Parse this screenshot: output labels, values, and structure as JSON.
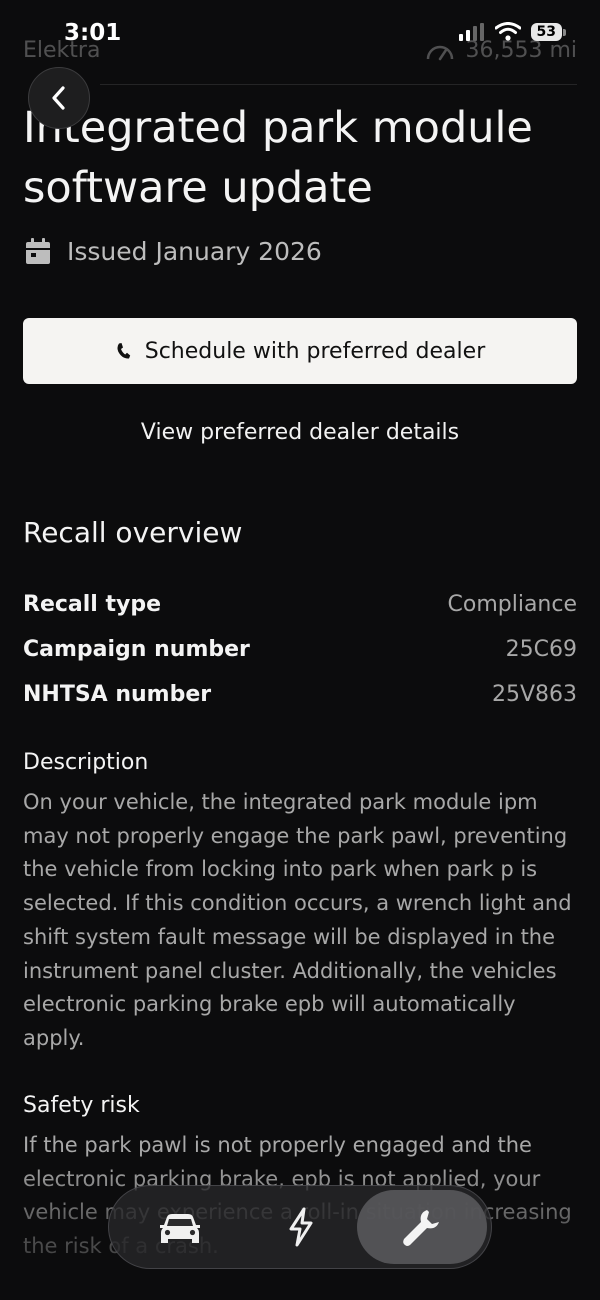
{
  "status_bar": {
    "time": "3:01",
    "battery": "53"
  },
  "header": {
    "vehicle_name": "Elektra",
    "mileage": "36,553 mi"
  },
  "title": "Integrated park module software update",
  "issued": "Issued January 2026",
  "schedule_button": "Schedule with preferred dealer",
  "dealer_link": "View preferred dealer details",
  "overview": {
    "title": "Recall overview",
    "rows": [
      {
        "label": "Recall type",
        "value": "Compliance"
      },
      {
        "label": "Campaign number",
        "value": "25C69"
      },
      {
        "label": "NHTSA number",
        "value": "25V863"
      }
    ]
  },
  "description": {
    "heading": "Description",
    "text": "On your vehicle, the integrated park module ipm may not properly engage the park pawl, preventing the vehicle from locking into park when park p is selected. If this condition occurs, a wrench light and shift system fault message will be displayed in the instrument panel cluster. Additionally, the vehicles electronic parking brake epb will automatically apply."
  },
  "safety_risk": {
    "heading": "Safety risk",
    "text": "If the park pawl is not properly engaged and the electronic parking brake, epb is not applied, your vehicle may experience a roll-in situation increasing the risk of a crash."
  },
  "tab_bar": {
    "tabs": [
      {
        "icon": "car-icon",
        "active": false
      },
      {
        "icon": "lightning-icon",
        "active": false
      },
      {
        "icon": "wrench-icon",
        "active": true
      }
    ]
  }
}
